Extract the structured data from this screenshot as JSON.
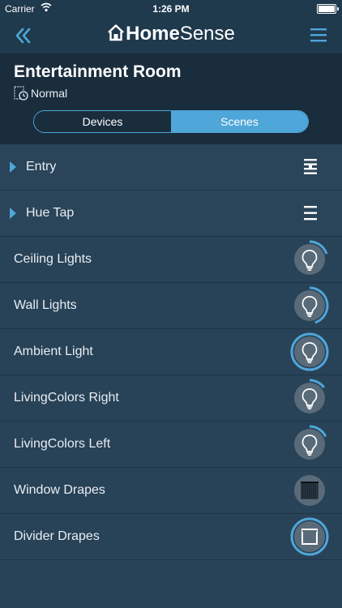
{
  "status_bar": {
    "carrier": "Carrier",
    "time": "1:26 PM"
  },
  "navbar": {
    "logo_part1": "Home",
    "logo_part2": "Sense",
    "back_icon": "double-chevron-left-icon",
    "menu_icon": "hamburger-menu-icon"
  },
  "room": {
    "title": "Entertainment Room",
    "mode": "Normal",
    "mode_icon": "schedule-clock-icon"
  },
  "tabs": [
    {
      "label": "Devices",
      "selected": false
    },
    {
      "label": "Scenes",
      "selected": true
    }
  ],
  "groups": [
    {
      "label": "Entry",
      "icon": "switch-panel-icon"
    },
    {
      "label": "Hue Tap",
      "icon": "hue-tap-icon"
    }
  ],
  "devices": [
    {
      "label": "Ceiling Lights",
      "icon": "light-bulb-icon",
      "level": 0.2,
      "highlighted": false
    },
    {
      "label": "Wall Lights",
      "icon": "light-bulb-icon",
      "level": 0.45,
      "highlighted": false
    },
    {
      "label": "Ambient Light",
      "icon": "light-bulb-icon",
      "level": 1.0,
      "highlighted": true
    },
    {
      "label": "LivingColors Right",
      "icon": "light-bulb-icon",
      "level": 0.15,
      "highlighted": false
    },
    {
      "label": "LivingColors Left",
      "icon": "light-bulb-icon",
      "level": 0.18,
      "highlighted": false
    },
    {
      "label": "Window Drapes",
      "icon": "closed-drapes-icon",
      "level": 0,
      "highlighted": false
    },
    {
      "label": "Divider Drapes",
      "icon": "open-drapes-icon",
      "level": 1.0,
      "highlighted": true
    }
  ],
  "colors": {
    "accent": "#4fa6d8",
    "background": "#284257",
    "header": "#1a2d3d",
    "icon_bg": "#596b79"
  }
}
